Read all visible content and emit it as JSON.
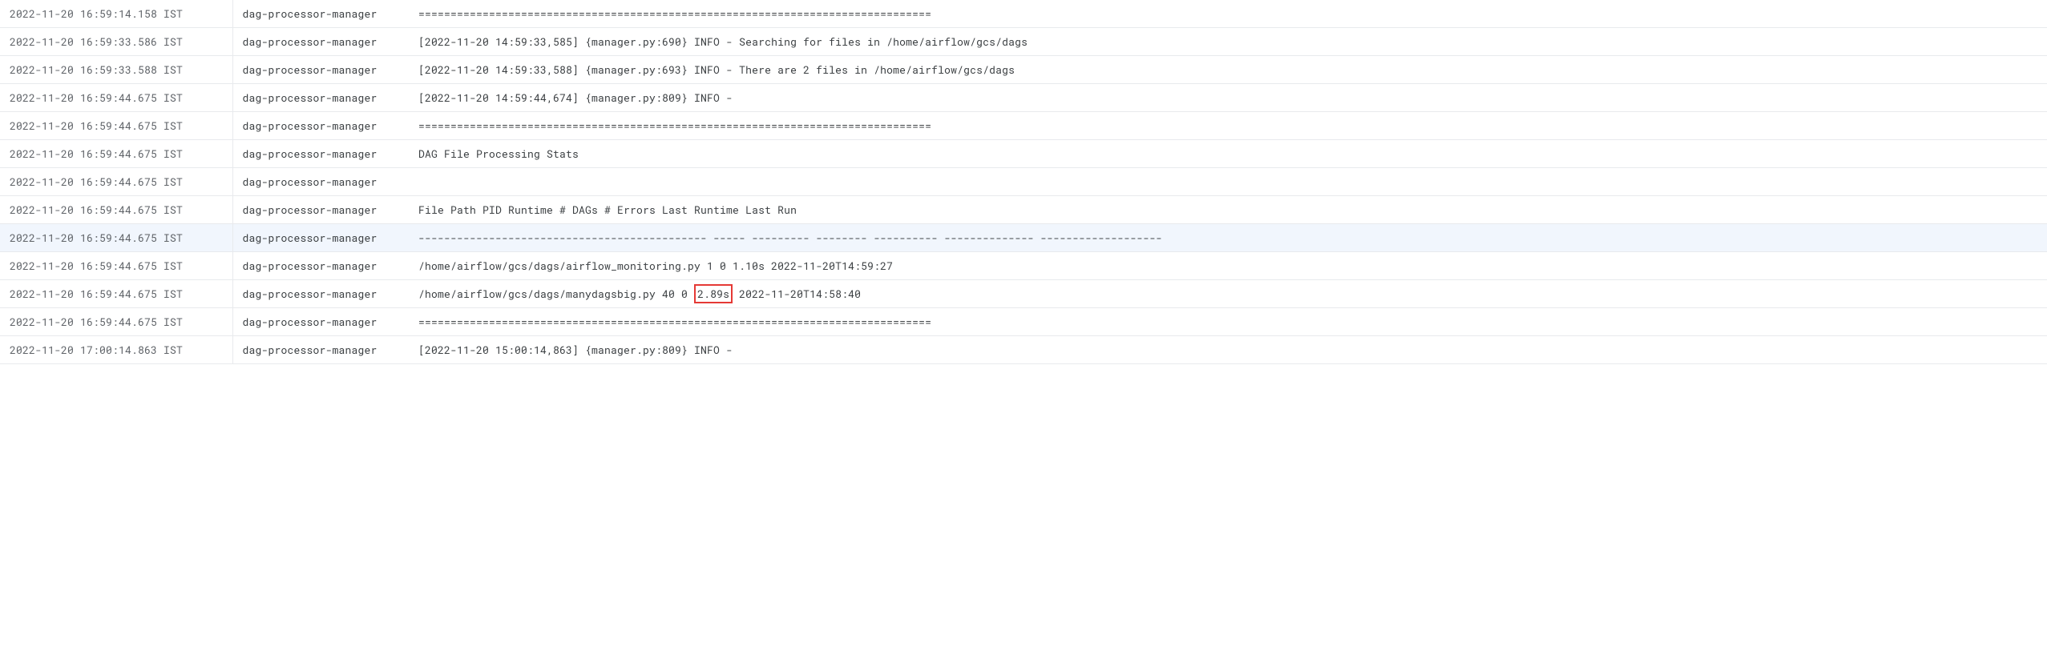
{
  "logs": [
    {
      "timestamp": "2022-11-20 16:59:14.158 IST",
      "source": "dag-processor-manager",
      "message": "================================================================================",
      "highlighted": false
    },
    {
      "timestamp": "2022-11-20 16:59:33.586 IST",
      "source": "dag-processor-manager",
      "message": "[2022-11-20 14:59:33,585] {manager.py:690} INFO - Searching for files in /home/airflow/gcs/dags",
      "highlighted": false
    },
    {
      "timestamp": "2022-11-20 16:59:33.588 IST",
      "source": "dag-processor-manager",
      "message": "[2022-11-20 14:59:33,588] {manager.py:693} INFO - There are 2 files in /home/airflow/gcs/dags",
      "highlighted": false
    },
    {
      "timestamp": "2022-11-20 16:59:44.675 IST",
      "source": "dag-processor-manager",
      "message": "[2022-11-20 14:59:44,674] {manager.py:809} INFO - ",
      "highlighted": false
    },
    {
      "timestamp": "2022-11-20 16:59:44.675 IST",
      "source": "dag-processor-manager",
      "message": "================================================================================",
      "highlighted": false
    },
    {
      "timestamp": "2022-11-20 16:59:44.675 IST",
      "source": "dag-processor-manager",
      "message": "DAG File Processing Stats",
      "highlighted": false
    },
    {
      "timestamp": "2022-11-20 16:59:44.675 IST",
      "source": "dag-processor-manager",
      "message": "",
      "highlighted": false
    },
    {
      "timestamp": "2022-11-20 16:59:44.675 IST",
      "source": "dag-processor-manager",
      "message": "File Path PID Runtime # DAGs # Errors Last Runtime Last Run",
      "highlighted": false
    },
    {
      "timestamp": "2022-11-20 16:59:44.675 IST",
      "source": "dag-processor-manager",
      "message": "--------------------------------------------- ----- --------- -------- ---------- -------------- -------------------",
      "highlighted": true
    },
    {
      "timestamp": "2022-11-20 16:59:44.675 IST",
      "source": "dag-processor-manager",
      "message": "/home/airflow/gcs/dags/airflow_monitoring.py 1 0 1.10s 2022-11-20T14:59:27",
      "highlighted": false
    },
    {
      "timestamp": "2022-11-20 16:59:44.675 IST",
      "source": "dag-processor-manager",
      "message_prefix": "/home/airflow/gcs/dags/manydagsbig.py 40 0 ",
      "message_highlight": "2.89s",
      "message_suffix": " 2022-11-20T14:58:40",
      "highlighted": false,
      "has_highlight_box": true
    },
    {
      "timestamp": "2022-11-20 16:59:44.675 IST",
      "source": "dag-processor-manager",
      "message": "================================================================================",
      "highlighted": false
    },
    {
      "timestamp": "2022-11-20 17:00:14.863 IST",
      "source": "dag-processor-manager",
      "message": "[2022-11-20 15:00:14,863] {manager.py:809} INFO - ",
      "highlighted": false
    }
  ]
}
